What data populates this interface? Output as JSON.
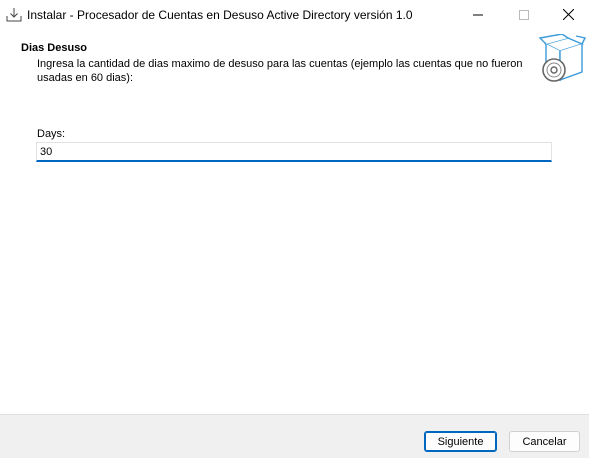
{
  "window": {
    "title": "Instalar - Procesador de Cuentas en Desuso Active Directory versión 1.0",
    "icon": "installer-download-icon",
    "controls": [
      "minimize-icon",
      "maximize-icon",
      "close-icon"
    ]
  },
  "header": {
    "title": "Dias Desuso",
    "description": "Ingresa la cantidad de dias maximo de desuso para las cuentas (ejemplo las cuentas que no fueron usadas en 60 dias):",
    "graphic": "box-with-disc-icon"
  },
  "form": {
    "days_label": "Days:",
    "days_value": "30"
  },
  "footer": {
    "next_label": "Siguiente",
    "cancel_label": "Cancelar"
  },
  "colors": {
    "accent": "#0067c0",
    "footer_bg": "#f0f0f0",
    "graphic": "#3b9ad9"
  }
}
